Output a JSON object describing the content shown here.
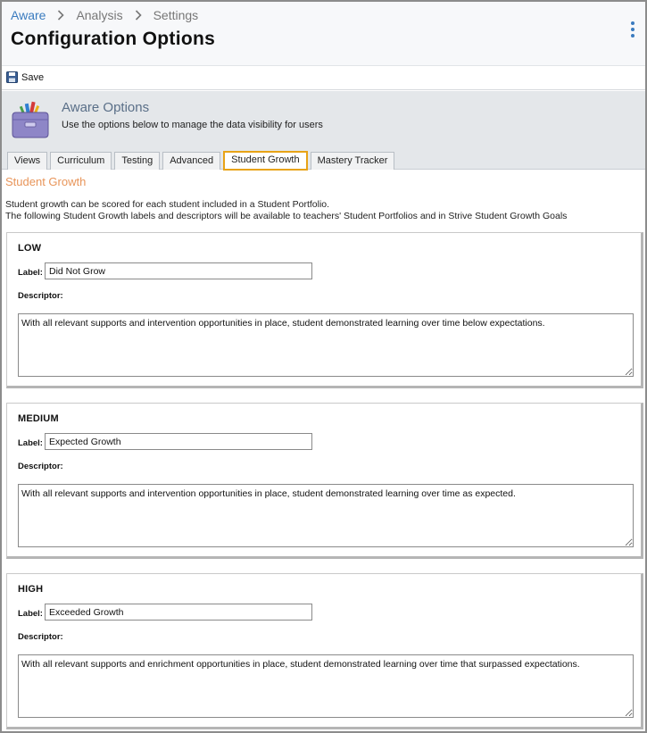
{
  "breadcrumb": {
    "items": [
      "Aware",
      "Analysis",
      "Settings"
    ]
  },
  "page": {
    "title": "Configuration Options"
  },
  "toolbar": {
    "save_label": "Save"
  },
  "banner": {
    "title": "Aware Options",
    "subtitle": "Use the options below to manage the data visibility for users"
  },
  "tabs": [
    {
      "label": "Views",
      "active": false
    },
    {
      "label": "Curriculum",
      "active": false
    },
    {
      "label": "Testing",
      "active": false
    },
    {
      "label": "Advanced",
      "active": false
    },
    {
      "label": "Student Growth",
      "active": true
    },
    {
      "label": "Mastery Tracker",
      "active": false
    }
  ],
  "section": {
    "title": "Student Growth",
    "intro_line1": "Student growth can be scored for each student included in a Student Portfolio.",
    "intro_line2": "The following Student Growth labels and descriptors will be available to teachers' Student Portfolios and in Strive Student Growth Goals"
  },
  "panels": [
    {
      "title": "LOW",
      "label_caption": "Label:",
      "label_value": "Did Not Grow",
      "descriptor_caption": "Descriptor:",
      "descriptor_value": "With all relevant supports and intervention opportunities in place, student demonstrated learning over time below expectations."
    },
    {
      "title": "MEDIUM",
      "label_caption": "Label:",
      "label_value": "Expected Growth",
      "descriptor_caption": "Descriptor:",
      "descriptor_value": "With all relevant supports and intervention opportunities in place, student demonstrated learning over time as expected."
    },
    {
      "title": "HIGH",
      "label_caption": "Label:",
      "label_value": "Exceeded Growth",
      "descriptor_caption": "Descriptor:",
      "descriptor_value": "With all relevant supports and enrichment opportunities in place, student demonstrated learning over time that surpassed expectations."
    }
  ],
  "colors": {
    "link": "#3a7bbf",
    "section_title": "#e8955a",
    "active_tab_border": "#e8a317",
    "banner_bg": "#e4e7ea"
  },
  "icons": [
    "chevron-right-icon",
    "kebab-menu-icon",
    "save-disk-icon",
    "toolbox-icon"
  ]
}
